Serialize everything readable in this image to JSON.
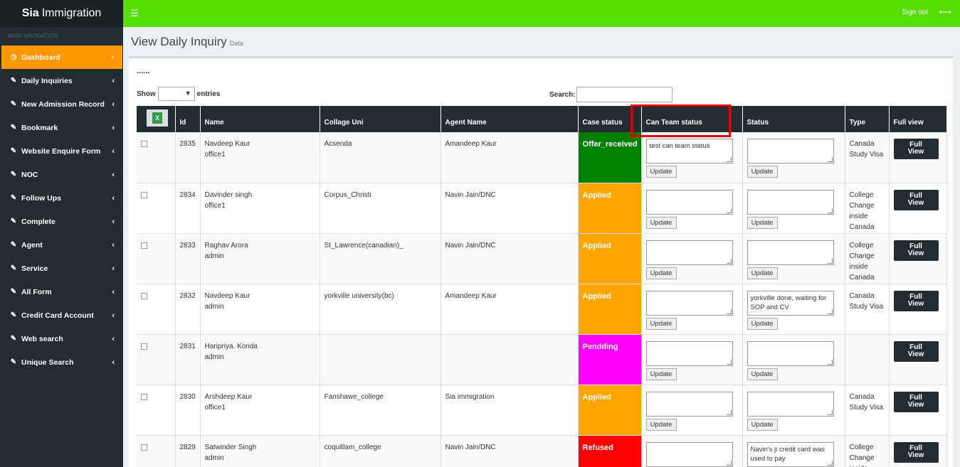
{
  "app": {
    "brand_bold": "Sia",
    "brand_rest": "Immigration"
  },
  "topbar": {
    "signout": "Sign out"
  },
  "sidebar": {
    "header": "MAIN NAVIGATION",
    "items": [
      {
        "label": "Dashboard",
        "icon": "dashboard-icon"
      },
      {
        "label": "Daily Inquiries",
        "icon": "edit-icon"
      },
      {
        "label": "New Admission Record",
        "icon": "edit-icon"
      },
      {
        "label": "Bookmark",
        "icon": "edit-icon"
      },
      {
        "label": "Website Enquire Form",
        "icon": "edit-icon"
      },
      {
        "label": "NOC",
        "icon": "edit-icon"
      },
      {
        "label": "Follow Ups",
        "icon": "edit-icon"
      },
      {
        "label": "Complete",
        "icon": "edit-icon"
      },
      {
        "label": "Agent",
        "icon": "edit-icon"
      },
      {
        "label": "Service",
        "icon": "edit-icon"
      },
      {
        "label": "All Form",
        "icon": "edit-icon"
      },
      {
        "label": "Credit Card Account",
        "icon": "edit-icon"
      },
      {
        "label": "Web search",
        "icon": "edit-icon"
      },
      {
        "label": "Unique Search",
        "icon": "edit-icon"
      }
    ]
  },
  "page": {
    "title": "View Daily Inquiry",
    "subtitle": "Data",
    "dots": "......"
  },
  "controls": {
    "show": "Show",
    "entries": "entries",
    "search": "Search:"
  },
  "table": {
    "headers": {
      "id": "Id",
      "name": "Name",
      "college": "Collage Uni",
      "agent": "Agent Name",
      "case_status": "Case status",
      "can_team": "Can Team status",
      "status": "Status",
      "type": "Type",
      "full_view": "Full view"
    },
    "update_label": "Update",
    "full_view_line1": "Full",
    "full_view_line2": "View",
    "rows": [
      {
        "id": "2835",
        "name": "Navdeep Kaur",
        "office": "office1",
        "college": "Acsenda",
        "agent": "Amandeep Kaur",
        "case_status": "Offer_received",
        "case_color": "#008000",
        "can_team": "test can team status",
        "status": "",
        "type": "Canada Study Visa"
      },
      {
        "id": "2834",
        "name": "Davinder singh",
        "office": "office1",
        "college": "Corpus_Christi",
        "agent": "Navin Jain/DNC",
        "case_status": "Applied",
        "case_color": "#ffa500",
        "can_team": "",
        "status": "",
        "type": "College Change inside Canada"
      },
      {
        "id": "2833",
        "name": "Raghav Arora",
        "office": "admin",
        "college": "St_Lawrence(canadian)_",
        "agent": "Navin Jain/DNC",
        "case_status": "Applied",
        "case_color": "#ffa500",
        "can_team": "",
        "status": "",
        "type": "College Change inside Canada"
      },
      {
        "id": "2832",
        "name": "Navdeep Kaur",
        "office": "admin",
        "college": "yorkville university(bc)",
        "agent": "Amandeep Kaur",
        "case_status": "Applied",
        "case_color": "#ffa500",
        "can_team": "",
        "status": " yorkville done, waiting for SOP and CV",
        "type": "Canada Study Visa"
      },
      {
        "id": "2831",
        "name": "Haripriya. Konda",
        "office": "admin",
        "college": "",
        "agent": "",
        "case_status": "Pendding",
        "case_color": "#ff00ff",
        "can_team": "",
        "status": "",
        "type": ""
      },
      {
        "id": "2830",
        "name": "Arshdeep Kaur",
        "office": "office1",
        "college": "Fanshawe_college",
        "agent": "Sia immigration",
        "case_status": "Applied",
        "case_color": "#ffa500",
        "can_team": "",
        "status": "",
        "type": "Canada Study Visa"
      },
      {
        "id": "2829",
        "name": "Satwinder Singh",
        "office": "admin",
        "college": "coquitlam_college",
        "agent": "Navin Jain/DNC",
        "case_status": "Refused",
        "case_color": "#ff0000",
        "can_team": "",
        "status": "Navin's ji credit card was used to pay",
        "type": "College Change inside"
      }
    ]
  }
}
